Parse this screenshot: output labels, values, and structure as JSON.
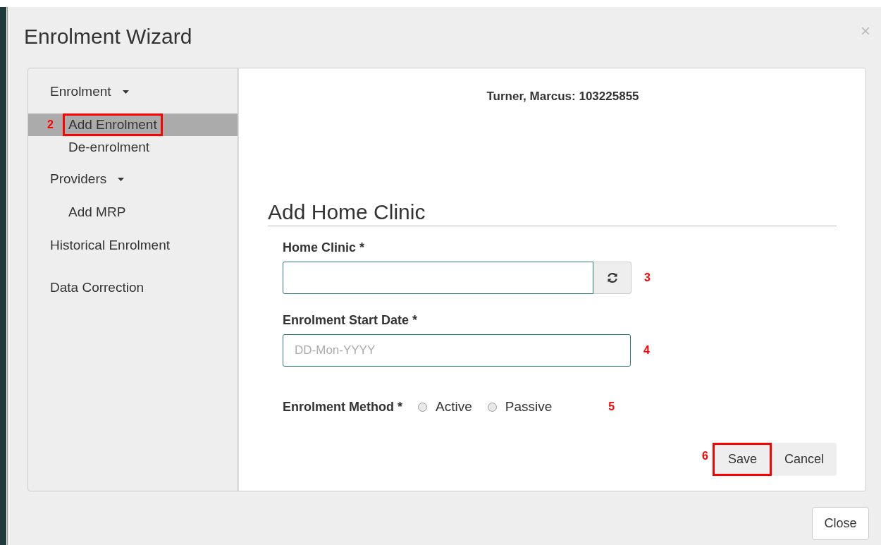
{
  "dialog": {
    "title": "Enrolment Wizard",
    "close_icon": "×"
  },
  "sidebar": {
    "items": [
      {
        "label": "Enrolment",
        "expanded": true,
        "children": [
          {
            "label": "Add Enrolment",
            "selected": true,
            "callout": "2",
            "outlined": true
          },
          {
            "label": "De-enrolment",
            "selected": false
          }
        ]
      },
      {
        "label": "Providers",
        "expanded": true,
        "children": [
          {
            "label": "Add MRP",
            "selected": false
          }
        ]
      },
      {
        "label": "Historical Enrolment",
        "selected": false
      },
      {
        "label": "Data Correction",
        "selected": false
      }
    ]
  },
  "patient_header": "Turner, Marcus: 103225855",
  "section_title": "Add Home Clinic",
  "form": {
    "fields": [
      {
        "kind": "lookup",
        "label": "Home Clinic *",
        "callout": "3"
      },
      {
        "kind": "date",
        "label": "Enrolment Start Date *",
        "placeholder": "DD-Mon-YYYY",
        "callout": "4"
      },
      {
        "kind": "radio",
        "label": "Enrolment Method *",
        "callout": "5",
        "options": [
          {
            "label": "Active",
            "selected": false
          },
          {
            "label": "Passive",
            "selected": false
          }
        ]
      }
    ]
  },
  "actions": [
    {
      "label": "Save",
      "callout": "6",
      "outlined": true
    },
    {
      "label": "Cancel",
      "outlined": false
    }
  ],
  "footer_button": "Close"
}
